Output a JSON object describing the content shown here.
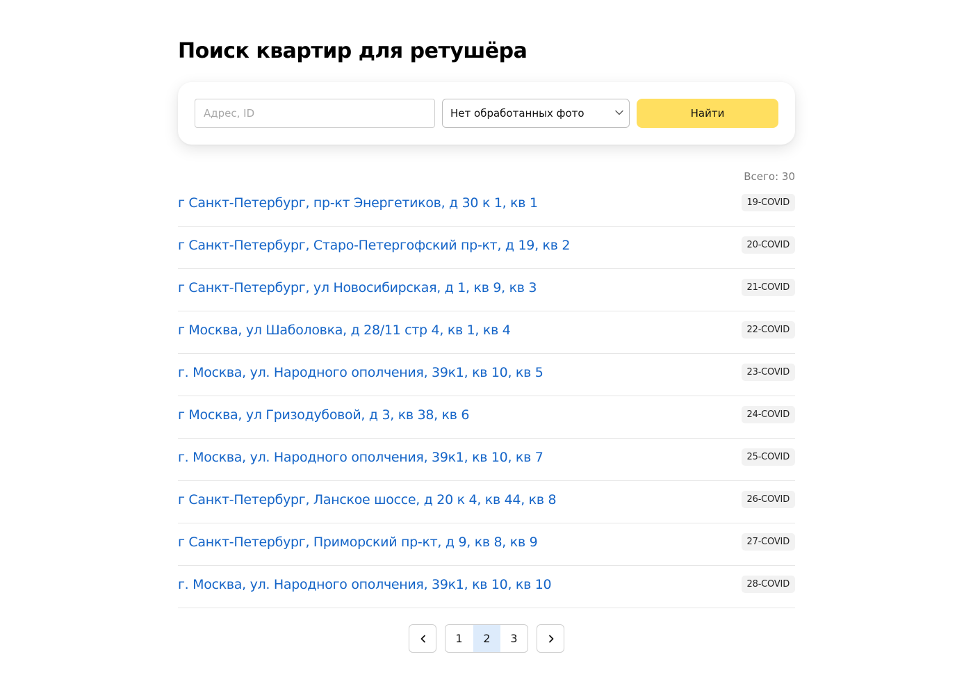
{
  "page": {
    "title": "Поиск квартир для ретушёра"
  },
  "search": {
    "placeholder": "Адрес, ID",
    "value": "",
    "filter_selected": "Нет обработанных фото",
    "submit_label": "Найти"
  },
  "results": {
    "total_label": "Всего: 30",
    "items": [
      {
        "address": "г Санкт-Петербург, пр-кт Энергетиков, д 30 к 1, кв 1",
        "id": "19-COVID"
      },
      {
        "address": "г Санкт-Петербург, Старо-Петергофский пр-кт, д 19, кв 2",
        "id": "20-COVID"
      },
      {
        "address": "г Санкт-Петербург, ул Новосибирская, д 1, кв 9, кв 3",
        "id": "21-COVID"
      },
      {
        "address": "г Москва, ул Шаболовка, д 28/11 стр 4, кв 1, кв 4",
        "id": "22-COVID"
      },
      {
        "address": "г. Москва, ул. Народного ополчения, 39к1, кв 10, кв 5",
        "id": "23-COVID"
      },
      {
        "address": "г Москва, ул Гризодубовой, д 3, кв 38, кв 6",
        "id": "24-COVID"
      },
      {
        "address": "г. Москва, ул. Народного ополчения, 39к1, кв 10, кв 7",
        "id": "25-COVID"
      },
      {
        "address": "г Санкт-Петербург, Ланское шоссе, д 20 к 4, кв 44, кв 8",
        "id": "26-COVID"
      },
      {
        "address": "г Санкт-Петербург, Приморский пр-кт, д 9, кв 8, кв 9",
        "id": "27-COVID"
      },
      {
        "address": "г. Москва, ул. Народного ополчения, 39к1, кв 10, кв 10",
        "id": "28-COVID"
      }
    ]
  },
  "pagination": {
    "pages": [
      "1",
      "2",
      "3"
    ],
    "current": "2",
    "prev_icon": "chevron-left-icon",
    "next_icon": "chevron-right-icon"
  },
  "colors": {
    "accent_button": "#ffdf60",
    "link": "#1565c8",
    "current_page": "#ddebfb",
    "badge_bg": "#f2f2f2"
  }
}
